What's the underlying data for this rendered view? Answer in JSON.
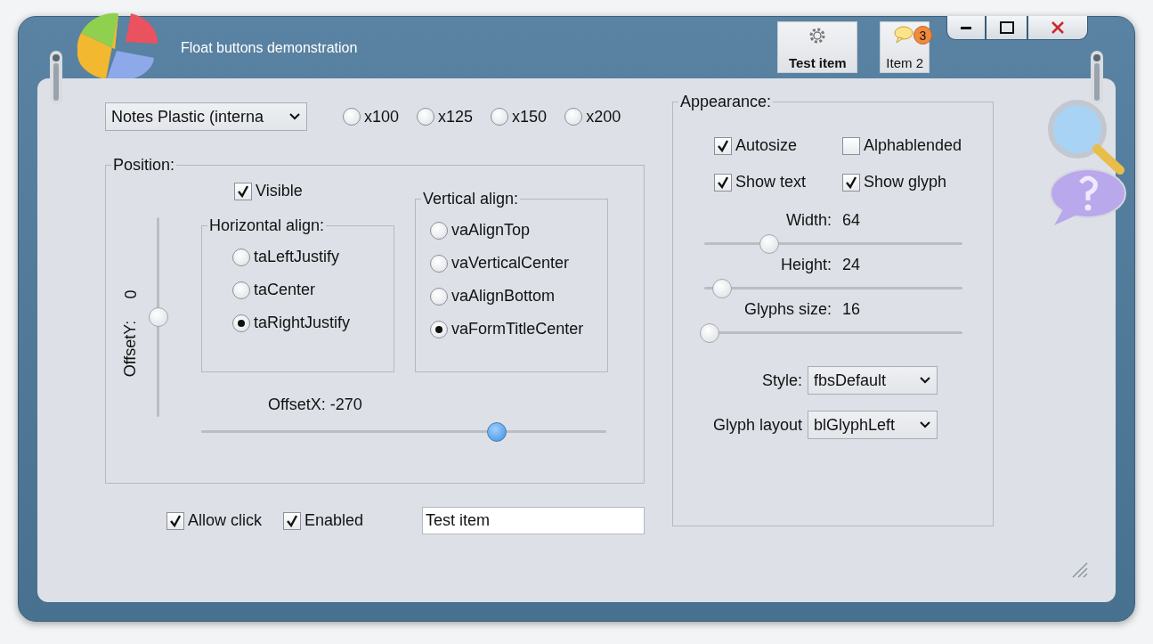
{
  "window": {
    "title": "Float buttons demonstration"
  },
  "float_buttons": [
    {
      "label": "Test item",
      "kind": "gear",
      "selected": true
    },
    {
      "label": "Item 2",
      "kind": "chat",
      "selected": false,
      "badge": "3"
    }
  ],
  "skin_select": {
    "value": "Notes Plastic (interna"
  },
  "scale": [
    {
      "label": "x100",
      "selected": false
    },
    {
      "label": "x125",
      "selected": false
    },
    {
      "label": "x150",
      "selected": false
    },
    {
      "label": "x200",
      "selected": false
    }
  ],
  "position": {
    "title": "Position:",
    "visible": {
      "label": "Visible",
      "checked": true
    },
    "offset_y": {
      "label": "OffsetY:",
      "value": "0",
      "level": 0.5
    },
    "horizontal_align": {
      "title": "Horizontal align:",
      "options": [
        {
          "label": "taLeftJustify",
          "selected": false
        },
        {
          "label": "taCenter",
          "selected": false
        },
        {
          "label": "taRightJustify",
          "selected": true
        }
      ]
    },
    "vertical_align": {
      "title": "Vertical align:",
      "options": [
        {
          "label": "vaAlignTop",
          "selected": false
        },
        {
          "label": "vaVerticalCenter",
          "selected": false
        },
        {
          "label": "vaAlignBottom",
          "selected": false
        },
        {
          "label": "vaFormTitleCenter",
          "selected": true
        }
      ]
    },
    "offset_x": {
      "label": "OffsetX: -270",
      "level": 0.73
    }
  },
  "options": [
    {
      "label": "Allow click",
      "checked": true
    },
    {
      "label": "Enabled",
      "checked": true
    }
  ],
  "caption_field": {
    "value": "Test item"
  },
  "appearance": {
    "title": "Appearance:",
    "checks": [
      {
        "label": "Autosize",
        "checked": true
      },
      {
        "label": "Alphablended",
        "checked": false
      },
      {
        "label": "Show text",
        "checked": true
      },
      {
        "label": "Show glyph",
        "checked": true
      }
    ],
    "sliders": [
      {
        "label": "Width:",
        "value": "64",
        "level": 0.25
      },
      {
        "label": "Height:",
        "value": "24",
        "level": 0.07
      },
      {
        "label": "Glyphs size:",
        "value": "16",
        "level": 0.02
      }
    ],
    "selects": [
      {
        "label": "Style:",
        "value": "fbsDefault"
      },
      {
        "label": "Glyph layout",
        "value": "blGlyphLeft"
      }
    ]
  }
}
